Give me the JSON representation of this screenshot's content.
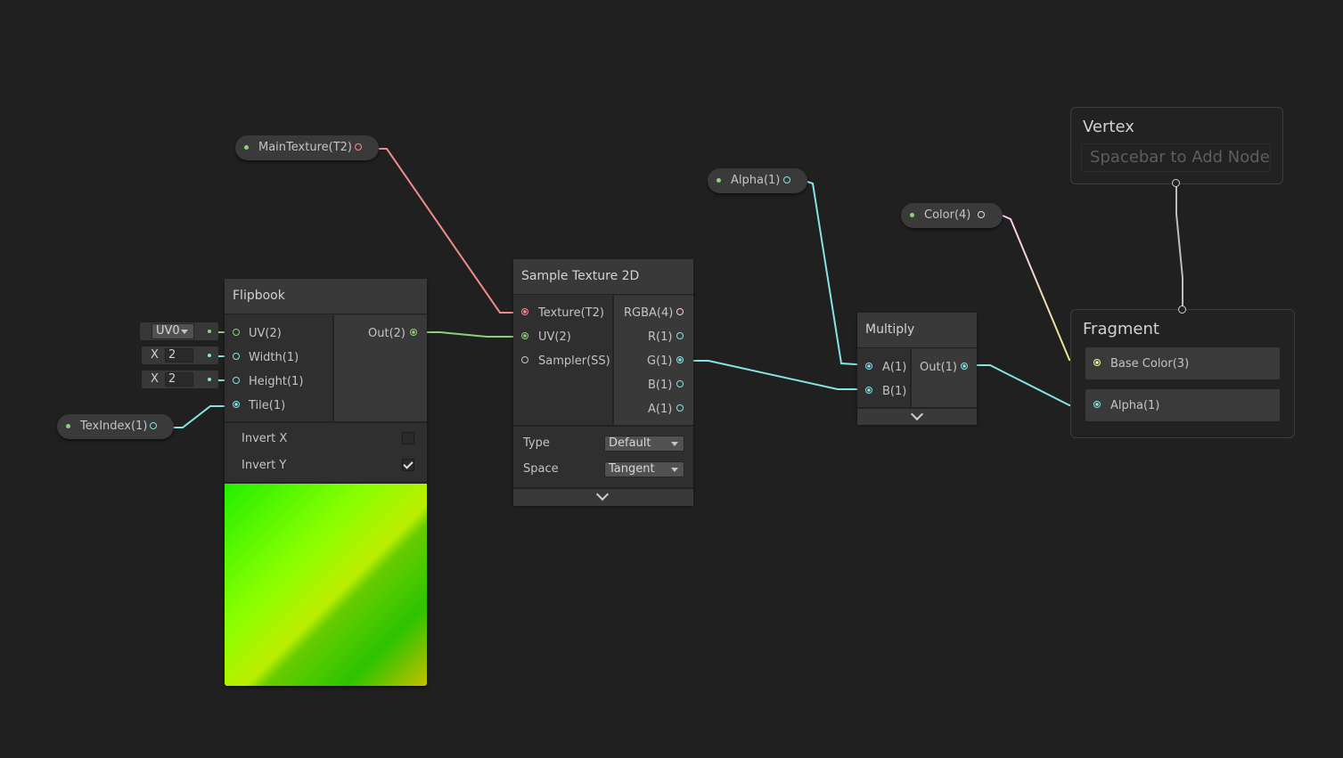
{
  "properties": {
    "main_texture": "MainTexture(T2)",
    "alpha": "Alpha(1)",
    "color": "Color(4)",
    "tex_index": "TexIndex(1)"
  },
  "flipbook": {
    "title": "Flipbook",
    "inputs": [
      "UV(2)",
      "Width(1)",
      "Height(1)",
      "Tile(1)"
    ],
    "output": "Out(2)",
    "uv_dropdown": "UV0",
    "width_axis": "X",
    "width_value": "2",
    "height_axis": "X",
    "height_value": "2",
    "invert_x_label": "Invert X",
    "invert_x_checked": false,
    "invert_y_label": "Invert Y",
    "invert_y_checked": true
  },
  "sample_texture": {
    "title": "Sample Texture 2D",
    "inputs": [
      "Texture(T2)",
      "UV(2)",
      "Sampler(SS)"
    ],
    "outputs": [
      "RGBA(4)",
      "R(1)",
      "G(1)",
      "B(1)",
      "A(1)"
    ],
    "type_label": "Type",
    "type_value": "Default",
    "space_label": "Space",
    "space_value": "Tangent"
  },
  "multiply": {
    "title": "Multiply",
    "inputs": [
      "A(1)",
      "B(1)"
    ],
    "output": "Out(1)"
  },
  "vertex": {
    "title": "Vertex",
    "placeholder": "Spacebar to Add Node"
  },
  "fragment": {
    "title": "Fragment",
    "slots": [
      "Base Color(3)",
      "Alpha(1)"
    ]
  },
  "colors": {
    "background": "#202020",
    "vector2": "#8ed07a",
    "float": "#84e4e7",
    "texture": "#ff8b8b",
    "vector4": "#fbcbf4",
    "vector3": "#f6ff9a"
  }
}
